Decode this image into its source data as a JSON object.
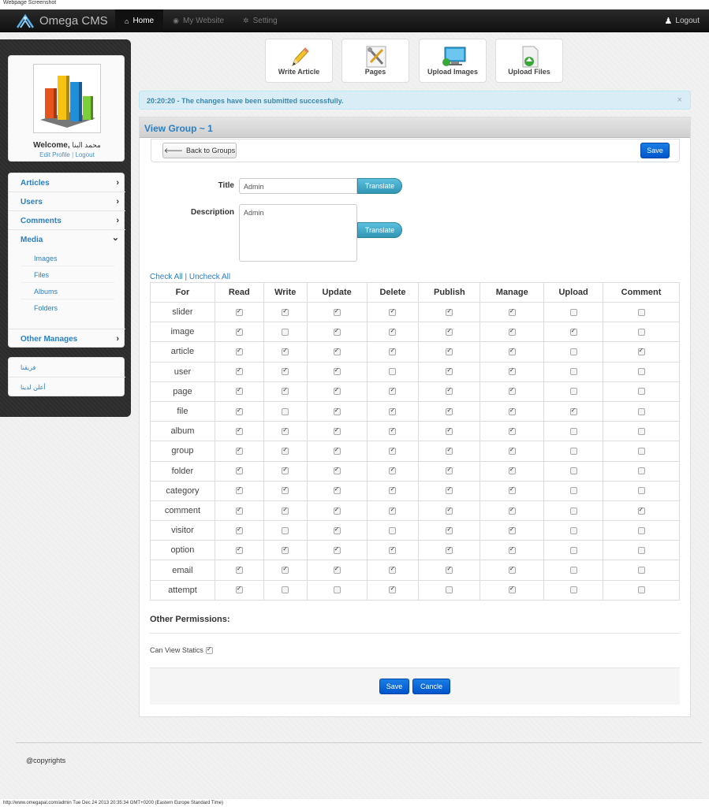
{
  "capture": {
    "title": "Webpage Screenshot",
    "footer": "http://www.omegapal.com/admin Tue Dec 24 2013 20:35:34 GMT+0200 (Eastern Europe Standard Time)"
  },
  "topbar": {
    "brand": "Omega CMS",
    "nav": [
      {
        "label": "Home",
        "icon": "home-icon"
      },
      {
        "label": "My Website",
        "icon": "globe-icon"
      },
      {
        "label": "Setting",
        "icon": "gear-icon"
      }
    ],
    "logout": "Logout"
  },
  "sidebar": {
    "welcome": "Welcome,",
    "user_name": "محمد البنا",
    "edit_profile": "Edit Profile",
    "separator": "|",
    "logout": "Logout",
    "menu": [
      {
        "label": "Articles",
        "chevron": "›"
      },
      {
        "label": "Users",
        "chevron": "›"
      },
      {
        "label": "Comments",
        "chevron": "›"
      },
      {
        "label": "Media",
        "chevron": "⌄"
      }
    ],
    "media_sub": [
      "Images",
      "Files",
      "Albums",
      "Folders"
    ],
    "other": "Other Manages",
    "extra": [
      "فريقنا",
      "أعلن لدينا"
    ]
  },
  "tiles": [
    {
      "label": "Write Article",
      "icon": "pencil-icon"
    },
    {
      "label": "Pages",
      "icon": "tools-icon"
    },
    {
      "label": "Upload Images",
      "icon": "monitor-upload-icon"
    },
    {
      "label": "Upload Files",
      "icon": "file-upload-icon"
    }
  ],
  "alert": {
    "message": "20:20:20 - The changes have been submitted successfully.",
    "close": "×"
  },
  "panel": {
    "title": "View Group ~ 1",
    "back_label": "Back to Groups",
    "save_label": "Save",
    "title_label": "Title",
    "title_value": "Admin",
    "description_label": "Description",
    "description_value": "Admin",
    "translate_label": "Translate"
  },
  "permissions": {
    "check_all": "Check All",
    "separator": " | ",
    "uncheck_all": "Uncheck All",
    "columns": [
      "For",
      "Read",
      "Write",
      "Update",
      "Delete",
      "Publish",
      "Manage",
      "Upload",
      "Comment"
    ],
    "rows": [
      {
        "name": "slider",
        "checks": [
          1,
          1,
          1,
          1,
          1,
          1,
          0,
          0
        ]
      },
      {
        "name": "image",
        "checks": [
          1,
          0,
          1,
          1,
          1,
          1,
          1,
          0
        ]
      },
      {
        "name": "article",
        "checks": [
          1,
          1,
          1,
          1,
          1,
          1,
          0,
          1
        ]
      },
      {
        "name": "user",
        "checks": [
          1,
          1,
          1,
          0,
          1,
          1,
          0,
          0
        ]
      },
      {
        "name": "page",
        "checks": [
          1,
          1,
          1,
          1,
          1,
          1,
          0,
          0
        ]
      },
      {
        "name": "file",
        "checks": [
          1,
          0,
          1,
          1,
          1,
          1,
          1,
          0
        ]
      },
      {
        "name": "album",
        "checks": [
          1,
          1,
          1,
          1,
          1,
          1,
          0,
          0
        ]
      },
      {
        "name": "group",
        "checks": [
          1,
          1,
          1,
          1,
          1,
          1,
          0,
          0
        ]
      },
      {
        "name": "folder",
        "checks": [
          1,
          1,
          1,
          1,
          1,
          1,
          0,
          0
        ]
      },
      {
        "name": "category",
        "checks": [
          1,
          1,
          1,
          1,
          1,
          1,
          0,
          0
        ]
      },
      {
        "name": "comment",
        "checks": [
          1,
          1,
          1,
          1,
          1,
          1,
          0,
          1
        ]
      },
      {
        "name": "visitor",
        "checks": [
          1,
          0,
          1,
          0,
          1,
          1,
          0,
          0
        ]
      },
      {
        "name": "option",
        "checks": [
          1,
          1,
          1,
          1,
          1,
          1,
          0,
          0
        ]
      },
      {
        "name": "email",
        "checks": [
          1,
          1,
          1,
          1,
          1,
          1,
          0,
          0
        ]
      },
      {
        "name": "attempt",
        "checks": [
          1,
          0,
          0,
          1,
          0,
          1,
          0,
          0
        ]
      }
    ]
  },
  "other": {
    "heading": "Other Permissions:",
    "can_view_statics": "Can View Statics",
    "can_view_checked": true
  },
  "actions": {
    "save": "Save",
    "cancel": "Cancle"
  },
  "footer": {
    "copyright": "@copyrights"
  },
  "colors": {
    "link": "#2a7fc1",
    "primary": "#0055cc",
    "info": "#5bc0de",
    "alert_bg": "#d9edf7"
  }
}
